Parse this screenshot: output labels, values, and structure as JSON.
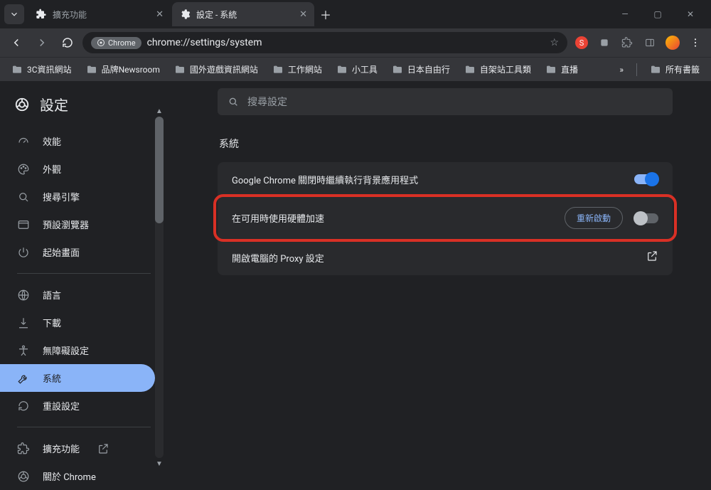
{
  "tabs": [
    {
      "title": "擴充功能",
      "active": false
    },
    {
      "title": "設定 - 系統",
      "active": true
    }
  ],
  "omnibox": {
    "chip_label": "Chrome",
    "url": "chrome://settings/system"
  },
  "bookmarks": [
    "3C資訊網站",
    "品牌Newsroom",
    "國外遊戲資訊網站",
    "工作網站",
    "小工具",
    "日本自由行",
    "自架站工具類",
    "直播"
  ],
  "bookmarks_overflow_label": "所有書籤",
  "settings_title": "設定",
  "sidebar": {
    "items": [
      {
        "label": "效能",
        "icon": "speed"
      },
      {
        "label": "外觀",
        "icon": "palette"
      },
      {
        "label": "搜尋引擎",
        "icon": "search"
      },
      {
        "label": "預設瀏覽器",
        "icon": "browser"
      },
      {
        "label": "起始畫面",
        "icon": "power"
      },
      {
        "label": "語言",
        "icon": "globe"
      },
      {
        "label": "下載",
        "icon": "download"
      },
      {
        "label": "無障礙設定",
        "icon": "accessibility"
      },
      {
        "label": "系統",
        "icon": "wrench",
        "active": true
      },
      {
        "label": "重設設定",
        "icon": "reset"
      },
      {
        "label": "擴充功能",
        "icon": "extension",
        "external": true
      },
      {
        "label": "關於 Chrome",
        "icon": "chrome"
      }
    ]
  },
  "search_placeholder": "搜尋設定",
  "section_title": "系統",
  "rows": {
    "background": {
      "label": "Google Chrome 關閉時繼續執行背景應用程式",
      "enabled": true
    },
    "hw_accel": {
      "label": "在可用時使用硬體加速",
      "relaunch": "重新啟動",
      "enabled": false
    },
    "proxy": {
      "label": "開啟電腦的 Proxy 設定"
    }
  }
}
